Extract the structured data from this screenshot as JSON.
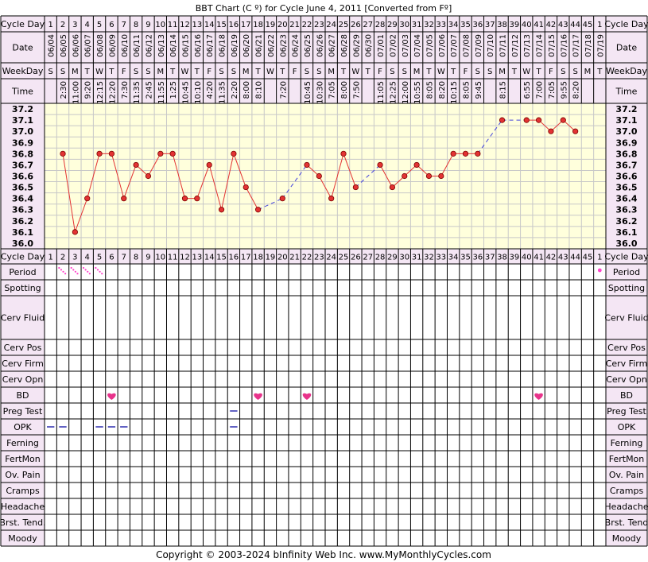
{
  "title": "BBT Chart (C º) for Cycle June 4, 2011  [Converted from Fº]",
  "copyright": "Copyright © 2003-2024 bInfinity Web Inc.     www.MyMonthlyCycles.com",
  "colors": {
    "background": "#ffffff",
    "label_cell": "#f4e6f4",
    "chart_area": "#ffffdc",
    "grid": "#c8c8c8",
    "line": "#e33333",
    "dot": "#e33333",
    "dash_line": "#4444dd",
    "period": "#ff44cc",
    "heart": "#e8338b",
    "opk": "#3a3ab4",
    "pregtest": "#3a3ab4"
  },
  "labels": {
    "cycle_day": "Cycle Day",
    "date": "Date",
    "weekday": "WeekDay",
    "time": "Time",
    "period": "Period",
    "spotting": "Spotting",
    "cerv_fluid": "Cerv Fluid",
    "cerv_pos": "Cerv Pos",
    "cerv_firm": "Cerv Firm",
    "cerv_opn": "Cerv Opn",
    "bd": "BD",
    "preg_test": "Preg Test",
    "opk": "OPK",
    "ferning": "Ferning",
    "fertmon": "FertMon",
    "ov_pain": "Ov. Pain",
    "cramps": "Cramps",
    "headache": "Headache",
    "brst_tend": "Brst. Tend.",
    "brst_tend_right": "Brst. Tend",
    "moody": "Moody"
  },
  "chart_data": {
    "type": "line",
    "title": "BBT Chart (C º) for Cycle June 4, 2011  [Converted from Fº]",
    "ylim": [
      36.0,
      37.2
    ],
    "y_ticks": [
      "37.2",
      "37.1",
      "37.0",
      "36.9",
      "36.8",
      "36.7",
      "36.6",
      "36.5",
      "36.4",
      "36.3",
      "36.2",
      "36.1",
      "36.0"
    ],
    "days": [
      "1",
      "2",
      "3",
      "4",
      "5",
      "6",
      "7",
      "8",
      "9",
      "10",
      "11",
      "12",
      "13",
      "14",
      "15",
      "16",
      "17",
      "18",
      "19",
      "20",
      "21",
      "22",
      "23",
      "24",
      "25",
      "26",
      "27",
      "28",
      "29",
      "30",
      "31",
      "32",
      "33",
      "34",
      "35",
      "36",
      "37",
      "38",
      "39",
      "40",
      "41",
      "42",
      "43",
      "44",
      "45",
      "1"
    ],
    "dates": [
      "06/04",
      "06/05",
      "06/06",
      "06/07",
      "06/08",
      "06/09",
      "06/10",
      "06/11",
      "06/12",
      "06/13",
      "06/14",
      "06/15",
      "06/16",
      "06/17",
      "06/18",
      "06/19",
      "06/20",
      "06/21",
      "06/22",
      "06/23",
      "06/24",
      "06/25",
      "06/26",
      "06/27",
      "06/28",
      "06/29",
      "06/30",
      "07/01",
      "07/02",
      "07/03",
      "07/04",
      "07/05",
      "07/06",
      "07/07",
      "07/08",
      "07/09",
      "07/10",
      "07/11",
      "07/12",
      "07/13",
      "07/14",
      "07/15",
      "07/16",
      "07/17",
      "07/18",
      "07/19"
    ],
    "weekdays": [
      "S",
      "S",
      "M",
      "T",
      "W",
      "T",
      "F",
      "S",
      "S",
      "M",
      "T",
      "W",
      "T",
      "F",
      "S",
      "S",
      "M",
      "T",
      "W",
      "T",
      "F",
      "S",
      "S",
      "M",
      "T",
      "W",
      "T",
      "F",
      "S",
      "S",
      "M",
      "T",
      "W",
      "T",
      "F",
      "S",
      "S",
      "M",
      "T",
      "W",
      "T",
      "F",
      "S",
      "S",
      "M",
      "T"
    ],
    "times": [
      "",
      "2:30",
      "11:00",
      "9:20",
      "12:15",
      "12:20",
      "7:30",
      "11:35",
      "2:45",
      "11:55",
      "1:25",
      "10:45",
      "10:10",
      "4:20",
      "11:35",
      "2:20",
      "8:00",
      "8:10",
      "",
      "7:20",
      "",
      "10:45",
      "10:30",
      "7:05",
      "8:00",
      "7:50",
      "",
      "11:05",
      "12:25",
      "12:00",
      "10:55",
      "8:05",
      "8:20",
      "10:15",
      "8:05",
      "9:45",
      "",
      "8:15",
      "",
      "6:55",
      "7:00",
      "7:05",
      "9:55",
      "8:20",
      "",
      ""
    ],
    "temps": [
      null,
      36.8,
      36.1,
      36.4,
      36.8,
      36.8,
      36.4,
      36.7,
      36.6,
      36.8,
      36.8,
      36.4,
      36.4,
      36.7,
      36.3,
      36.8,
      36.5,
      36.3,
      null,
      36.4,
      null,
      36.7,
      36.6,
      36.4,
      36.8,
      36.5,
      null,
      36.7,
      36.5,
      36.6,
      36.7,
      36.6,
      36.6,
      36.8,
      36.8,
      36.8,
      null,
      37.1,
      null,
      37.1,
      37.1,
      37.0,
      37.1,
      37.0,
      null,
      null
    ],
    "period_days": [
      2,
      3,
      4,
      5
    ],
    "period_dot_days": [
      46
    ],
    "bd_days": [
      6,
      18,
      22,
      41
    ],
    "opk_days": [
      1,
      2,
      5,
      6,
      7,
      16
    ],
    "preg_test_days": [
      16
    ]
  }
}
